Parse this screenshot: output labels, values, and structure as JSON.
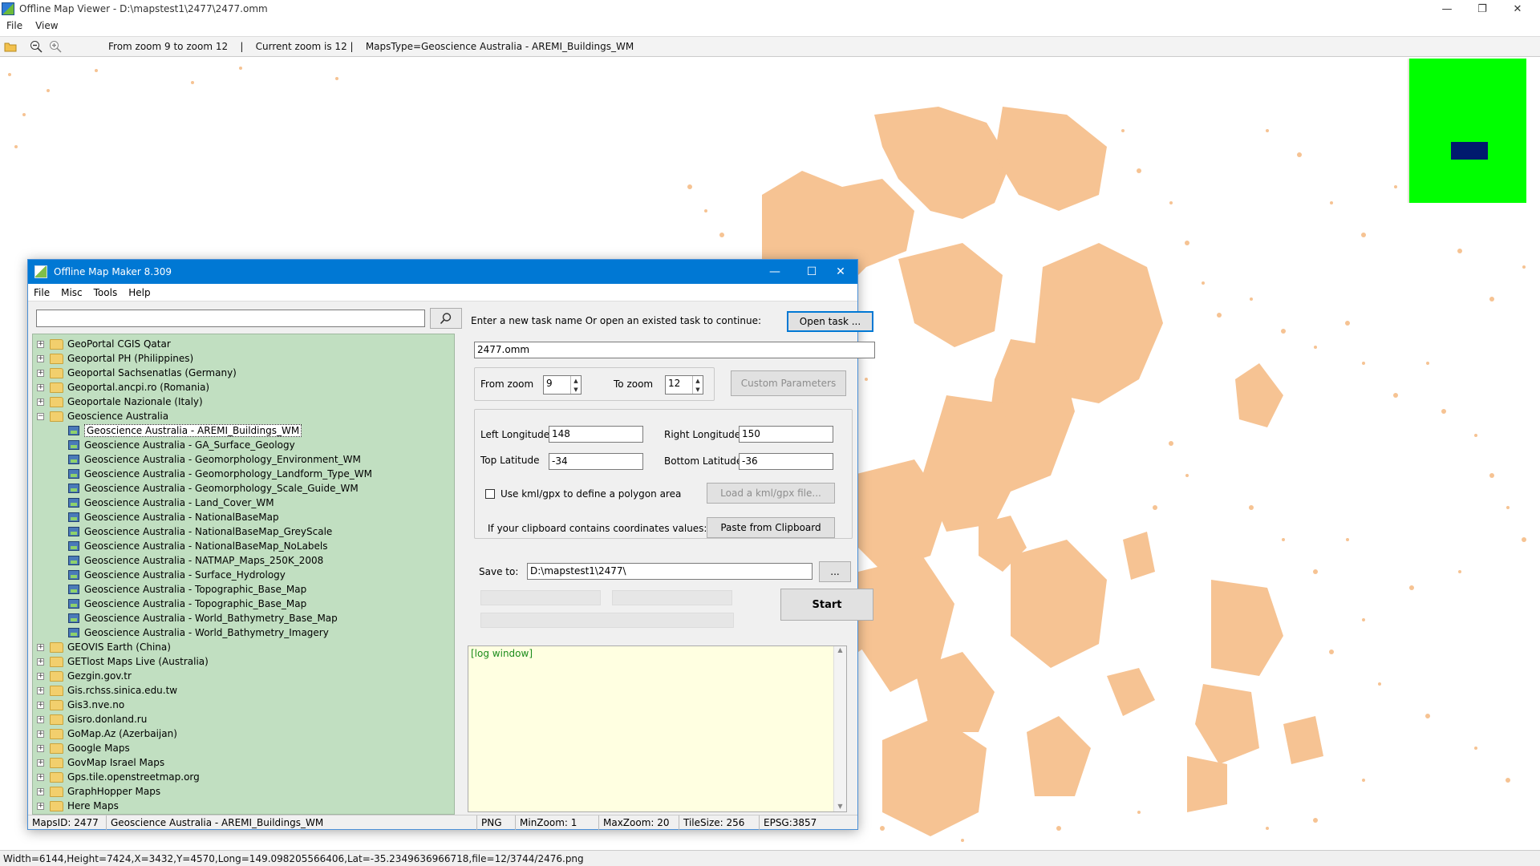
{
  "viewer": {
    "title": "Offline Map Viewer - D:\\mapstest1\\2477\\2477.omm",
    "menu": [
      "File",
      "View"
    ],
    "toolbar_info": "From zoom 9 to zoom 12    |    Current zoom is 12 |    MapsType=Geoscience Australia - AREMI_Buildings_WM",
    "status": "Width=6144,Height=7424,X=3432,Y=4570,Long=149.098205566406,Lat=-35.2349636966718,file=12/3744/2476.png",
    "colors": {
      "map_feature": "#f6c393",
      "overview_bg": "#00ff00",
      "overview_rect": "#001a6e"
    }
  },
  "dialog": {
    "title": "Offline Map Maker 8.309",
    "menu": [
      "File",
      "Misc",
      "Tools",
      "Help"
    ],
    "search_value": "",
    "tree": [
      {
        "label": "GeoPortal CGIS Qatar",
        "type": "folder"
      },
      {
        "label": "Geoportal PH (Philippines)",
        "type": "folder"
      },
      {
        "label": "Geoportal Sachsenatlas (Germany)",
        "type": "folder"
      },
      {
        "label": "Geoportal.ancpi.ro (Romania)",
        "type": "folder"
      },
      {
        "label": "Geoportale Nazionale (Italy)",
        "type": "folder"
      },
      {
        "label": "Geoscience Australia",
        "type": "open-folder"
      },
      {
        "label": "Geoscience Australia - AREMI_Buildings_WM",
        "type": "leaf",
        "selected": true
      },
      {
        "label": "Geoscience Australia - GA_Surface_Geology",
        "type": "leaf"
      },
      {
        "label": "Geoscience Australia - Geomorphology_Environment_WM",
        "type": "leaf"
      },
      {
        "label": "Geoscience Australia - Geomorphology_Landform_Type_WM",
        "type": "leaf"
      },
      {
        "label": "Geoscience Australia - Geomorphology_Scale_Guide_WM",
        "type": "leaf"
      },
      {
        "label": "Geoscience Australia - Land_Cover_WM",
        "type": "leaf"
      },
      {
        "label": "Geoscience Australia - NationalBaseMap",
        "type": "leaf"
      },
      {
        "label": "Geoscience Australia - NationalBaseMap_GreyScale",
        "type": "leaf"
      },
      {
        "label": "Geoscience Australia - NationalBaseMap_NoLabels",
        "type": "leaf"
      },
      {
        "label": "Geoscience Australia - NATMAP_Maps_250K_2008",
        "type": "leaf"
      },
      {
        "label": "Geoscience Australia - Surface_Hydrology",
        "type": "leaf"
      },
      {
        "label": "Geoscience Australia - Topographic_Base_Map",
        "type": "leaf"
      },
      {
        "label": "Geoscience Australia - Topographic_Base_Map",
        "type": "leaf"
      },
      {
        "label": "Geoscience Australia - World_Bathymetry_Base_Map",
        "type": "leaf"
      },
      {
        "label": "Geoscience Australia - World_Bathymetry_Imagery",
        "type": "leaf"
      },
      {
        "label": "GEOVIS Earth (China)",
        "type": "folder"
      },
      {
        "label": "GETlost Maps Live (Australia)",
        "type": "folder"
      },
      {
        "label": "Gezgin.gov.tr",
        "type": "folder"
      },
      {
        "label": "Gis.rchss.sinica.edu.tw",
        "type": "folder"
      },
      {
        "label": "Gis3.nve.no",
        "type": "folder"
      },
      {
        "label": "Gisro.donland.ru",
        "type": "folder"
      },
      {
        "label": "GoMap.Az (Azerbaijan)",
        "type": "folder"
      },
      {
        "label": "Google Maps",
        "type": "folder"
      },
      {
        "label": "GovMap Israel Maps",
        "type": "folder"
      },
      {
        "label": "Gps.tile.openstreetmap.org",
        "type": "folder"
      },
      {
        "label": "GraphHopper Maps",
        "type": "folder"
      },
      {
        "label": "Here Maps",
        "type": "folder"
      }
    ],
    "task_prompt": "Enter a new task name Or open an existed task to continue:",
    "open_task": "Open task ...",
    "task_name": "2477.omm",
    "from_zoom_label": "From zoom",
    "from_zoom": "9",
    "to_zoom_label": "To zoom",
    "to_zoom": "12",
    "custom_params": "Custom Parameters",
    "left_lon_label": "Left Longitude",
    "left_lon": "148",
    "right_lon_label": "Right Longitude",
    "right_lon": "150",
    "top_lat_label": "Top Latitude",
    "top_lat": "-34",
    "bottom_lat_label": "Bottom Latitude",
    "bottom_lat": "-36",
    "kml_label": "Use kml/gpx to define a polygon area",
    "load_kml": "Load a kml/gpx file...",
    "clipboard_label": "If your clipboard contains coordinates values:",
    "paste": "Paste from Clipboard",
    "save_label": "Save to:",
    "save_path": "D:\\mapstest1\\2477\\",
    "browse": "...",
    "start": "Start",
    "log": "[log window]",
    "status": {
      "maps_id": "MapsID: 2477",
      "maps_name": "Geoscience Australia - AREMI_Buildings_WM",
      "format": "PNG",
      "min_zoom": "MinZoom: 1",
      "max_zoom": "MaxZoom: 20",
      "tile_size": "TileSize: 256",
      "epsg": "EPSG:3857"
    }
  }
}
